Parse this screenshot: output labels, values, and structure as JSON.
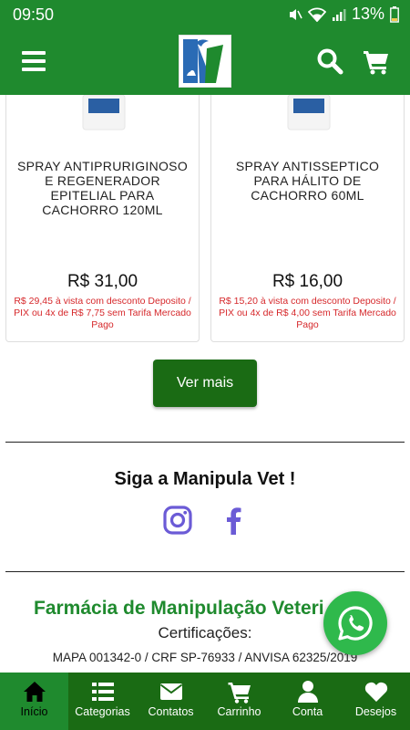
{
  "status_bar": {
    "time": "09:50",
    "battery": "13%"
  },
  "header": {
    "menu_icon": "hamburger-icon",
    "logo": "manipula-vet-logo",
    "search_icon": "search-icon",
    "cart_icon": "cart-icon"
  },
  "products": [
    {
      "name": "SPRAY ANTIPRURIGINOSO E REGENERADOR EPITELIAL PARA CACHORRO 120ML",
      "price": "R$ 31,00",
      "price_note": "R$ 29,45 à vista com desconto Deposito / PIX ou 4x de R$ 7,75 sem Tarifa Mercado Pago"
    },
    {
      "name": "SPRAY ANTISSEPTICO PARA HÁLITO DE CACHORRO 60ML",
      "price": "R$ 16,00",
      "price_note": "R$ 15,20 à vista com desconto Deposito / PIX ou 4x de R$ 4,00 sem Tarifa Mercado Pago"
    }
  ],
  "ver_mais": "Ver mais",
  "follow": {
    "title": "Siga a Manipula Vet !",
    "icons": [
      "instagram-icon",
      "facebook-icon"
    ]
  },
  "footer": {
    "pharmacy_title": "Farmácia de Manipulação Veteri",
    "cert_label": "Certificações:",
    "cert_list": "MAPA 001342-0 / CRF SP-76933 / ANVISA 62325/2019"
  },
  "bottom_nav": [
    {
      "label": "Início",
      "icon": "home-icon"
    },
    {
      "label": "Categorias",
      "icon": "list-icon"
    },
    {
      "label": "Contatos",
      "icon": "envelope-icon"
    },
    {
      "label": "Carrinho",
      "icon": "cart-icon"
    },
    {
      "label": "Conta",
      "icon": "user-icon"
    },
    {
      "label": "Desejos",
      "icon": "heart-icon"
    }
  ],
  "colors": {
    "primary_green": "#1f8a2e",
    "dark_green": "#1a6b14",
    "price_note_red": "#d6282b",
    "whatsapp_green": "#2fb94c",
    "social_purple": "#6b5bd6"
  }
}
